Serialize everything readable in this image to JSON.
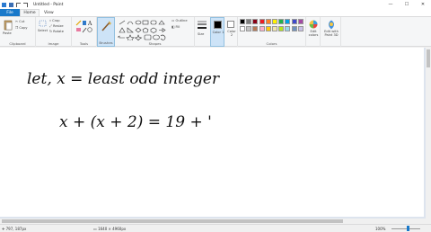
{
  "window": {
    "title": "Untitled - Paint",
    "minimize": "—",
    "maximize": "☐",
    "close": "✕"
  },
  "tabs": [
    "File",
    "Home",
    "View"
  ],
  "ribbon": {
    "clipboard": {
      "paste": "Paste",
      "cut": "Cut",
      "copy": "Copy",
      "label": "Clipboard"
    },
    "image": {
      "select": "Select",
      "crop": "Crop",
      "resize": "Resize",
      "rotate": "Rotate",
      "label": "Image"
    },
    "tools": {
      "label": "Tools"
    },
    "brushes": {
      "label": "Brushes"
    },
    "shapes": {
      "outline": "Outline",
      "fill": "Fill",
      "label": "Shapes"
    },
    "size": {
      "label": "Size"
    },
    "color1": {
      "label": "Color 1"
    },
    "color2": {
      "label": "Color 2"
    },
    "colors": {
      "label": "Colors",
      "edit": "Edit colors"
    },
    "paint3d": {
      "label": "Edit with Paint 3D"
    }
  },
  "palette": [
    "#000000",
    "#7f7f7f",
    "#880015",
    "#ed1c24",
    "#ff7f27",
    "#fff200",
    "#22b14c",
    "#00a2e8",
    "#3f48cc",
    "#a349a4",
    "#ffffff",
    "#c3c3c3",
    "#b97a57",
    "#ffaec9",
    "#ffc90e",
    "#efe4b0",
    "#b5e61d",
    "#99d9ea",
    "#7092be",
    "#c8bfe7"
  ],
  "canvas": {
    "line1": "let,  x =  least  odd  integer",
    "line2": "x + (x + 2)  =  19  + '"
  },
  "status": {
    "cursor": "797, 187px",
    "size": "1640 × 4960px",
    "zoom": "100%"
  },
  "colors": {
    "accent": "#1979ca",
    "ink": "#111111"
  }
}
